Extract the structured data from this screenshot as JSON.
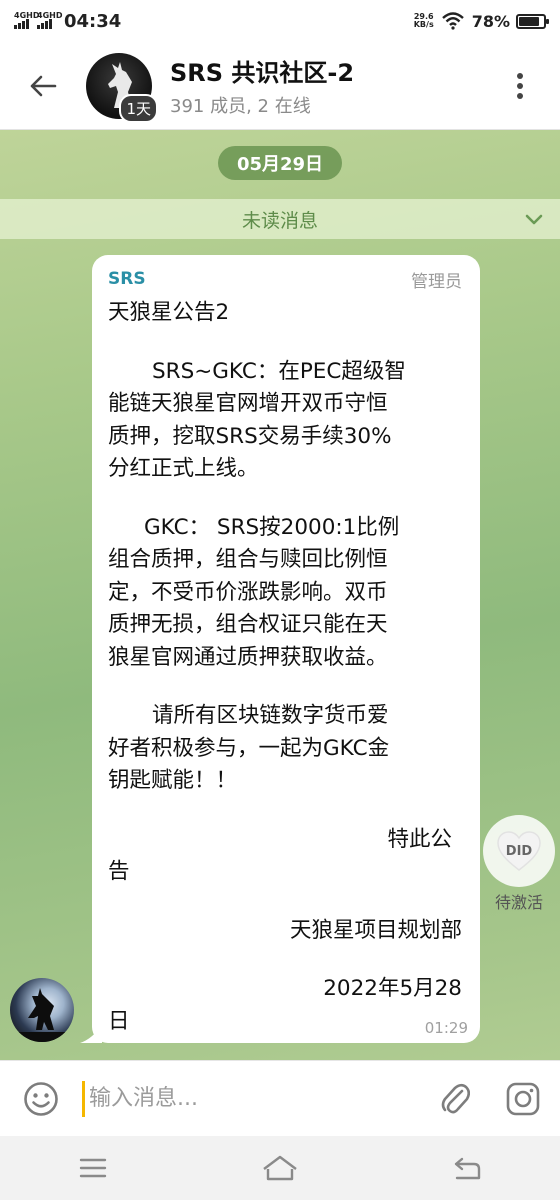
{
  "status_bar": {
    "sim1": "4GHD",
    "sim2": "4GHD",
    "time": "04:34",
    "net_speed_value": "29.6",
    "net_speed_unit": "KB/s",
    "battery": "78%",
    "battery_level": 0.78
  },
  "header": {
    "title": "SRS 共识社区-2",
    "subtitle": "391 成员, 2 在线",
    "avatar_badge": "1天"
  },
  "chat": {
    "date": "05月29日",
    "unread_label": "未读消息",
    "message": {
      "sender": "SRS",
      "role": "管理员",
      "lines": [
        "天狼星公告2",
        "SRS~GKC：在PEC超级智",
        "能链天狼星官网增开双币守恒",
        "质押，挖取SRS交易手续30%",
        "分红正式上线。",
        "GKC： SRS按2000:1比例",
        "组合质押，组合与赎回比例恒",
        "定，不受币价涨跌影响。双币",
        "质押无损，组合权证只能在天",
        "狼星官网通过质押获取收益。",
        "请所有区块链数字货币爱",
        "好者积极参与，一起为GKC金",
        "钥匙赋能！！",
        "特此公",
        "告",
        "天狼星项目规划部",
        "2022年5月28",
        "日"
      ],
      "time": "01:29"
    }
  },
  "did_widget": {
    "label": "DID",
    "caption": "待激活"
  },
  "composer": {
    "placeholder": "输入消息..."
  },
  "icons": {
    "back": "back-arrow-icon",
    "more": "more-vertical-icon",
    "emoji": "emoji-icon",
    "attach": "paperclip-icon",
    "camera": "camera-icon",
    "menu": "menu-icon",
    "home": "home-icon",
    "return": "return-icon"
  }
}
